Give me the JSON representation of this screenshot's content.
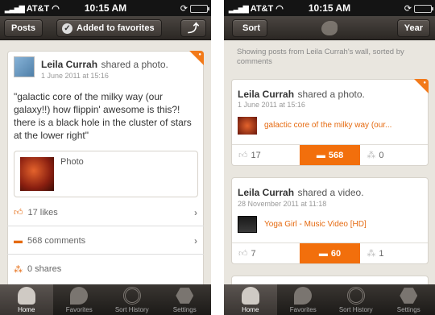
{
  "status": {
    "carrier": "AT&T",
    "time": "10:15 AM"
  },
  "left": {
    "nav": {
      "back": "Posts",
      "favorited": "Added to favorites"
    },
    "post": {
      "author": "Leila Currah",
      "action": "shared a photo.",
      "date": "1 June 2011 at 15:16",
      "text": "\"galactic core of the milky way (our galaxy!!) how flippin' awesome is this?! there is a black hole in the cluster of stars at the lower right\"",
      "attachment_label": "Photo"
    },
    "stats": {
      "likes": "17 likes",
      "comments": "568 comments",
      "shares": "0 shares"
    }
  },
  "right": {
    "nav": {
      "sort": "Sort",
      "year": "Year"
    },
    "info": "Showing posts from Leila Currah's wall, sorted by comments",
    "posts": [
      {
        "author": "Leila Currah",
        "action": "shared a photo.",
        "date": "1 June 2011 at 15:16",
        "link": "galactic core of the milky way (our...",
        "likes": "17",
        "comments": "568",
        "shares": "0"
      },
      {
        "author": "Leila Currah",
        "action": "shared a video.",
        "date": "28 November 2011 at 11:18",
        "link": "Yoga Girl - Music Video [HD]",
        "likes": "7",
        "comments": "60",
        "shares": "1"
      }
    ]
  },
  "tabs": [
    "Home",
    "Favorites",
    "Sort History",
    "Settings"
  ],
  "colors": {
    "accent": "#f27a1a",
    "navbar": "#3a3531",
    "background": "#e9e6df"
  }
}
